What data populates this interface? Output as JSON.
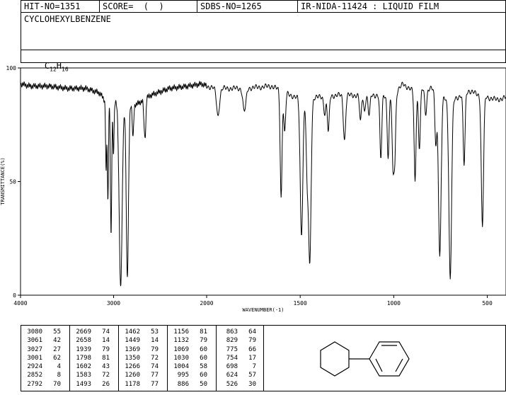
{
  "header": {
    "hit_no": "HIT-NO=1351",
    "score": "SCORE=  (  )",
    "sdbs_no": "SDBS-NO=1265",
    "method": "IR-NIDA-11424 : LIQUID FILM"
  },
  "compound": {
    "name": "CYCLOHEXYLBENZENE",
    "formula_c": "C",
    "formula_c_sub": "12",
    "formula_h": "H",
    "formula_h_sub": "16"
  },
  "chart_data": {
    "type": "line",
    "xlabel": "WAVENUMBER(-1)",
    "ylabel": "TRANSMITTANCE(%)",
    "xlim": [
      4000,
      400
    ],
    "ylim": [
      0,
      100
    ],
    "x_ticks": [
      4000,
      3000,
      2000,
      1500,
      1000,
      500
    ],
    "x_tick_labels": [
      "4000",
      "3000",
      "2000",
      "1500",
      "1000",
      "500"
    ],
    "y_ticks": [
      0,
      50,
      100
    ],
    "y_tick_labels": [
      "0",
      "50",
      "100"
    ],
    "baseline": [
      [
        4000,
        93
      ],
      [
        3900,
        92
      ],
      [
        3700,
        92
      ],
      [
        3500,
        91
      ],
      [
        3300,
        91
      ],
      [
        3150,
        89
      ],
      [
        3100,
        86
      ],
      [
        2750,
        84
      ],
      [
        2600,
        88
      ],
      [
        2400,
        91
      ],
      [
        2200,
        92
      ],
      [
        2050,
        93
      ],
      [
        1950,
        91
      ],
      [
        1800,
        91
      ],
      [
        1650,
        92
      ],
      [
        1580,
        89
      ],
      [
        1520,
        87
      ],
      [
        1420,
        87
      ],
      [
        1300,
        88
      ],
      [
        1150,
        88
      ],
      [
        1000,
        88
      ],
      [
        950,
        93
      ],
      [
        900,
        90
      ],
      [
        800,
        91
      ],
      [
        700,
        85
      ],
      [
        600,
        90
      ],
      [
        540,
        88
      ],
      [
        450,
        86
      ],
      [
        400,
        87
      ]
    ],
    "peaks": [
      {
        "x": 3080,
        "y": 55,
        "w": 6
      },
      {
        "x": 3061,
        "y": 42,
        "w": 6
      },
      {
        "x": 3027,
        "y": 27,
        "w": 7
      },
      {
        "x": 3001,
        "y": 62,
        "w": 6
      },
      {
        "x": 2924,
        "y": 4,
        "w": 16
      },
      {
        "x": 2852,
        "y": 8,
        "w": 12
      },
      {
        "x": 2792,
        "y": 70,
        "w": 8
      },
      {
        "x": 2669,
        "y": 74,
        "w": 8
      },
      {
        "x": 2658,
        "y": 74,
        "w": 6
      },
      {
        "x": 1939,
        "y": 79,
        "w": 8
      },
      {
        "x": 1798,
        "y": 81,
        "w": 8
      },
      {
        "x": 1602,
        "y": 43,
        "w": 5
      },
      {
        "x": 1583,
        "y": 72,
        "w": 5
      },
      {
        "x": 1493,
        "y": 26,
        "w": 7
      },
      {
        "x": 1462,
        "y": 53,
        "w": 6
      },
      {
        "x": 1449,
        "y": 14,
        "w": 7
      },
      {
        "x": 1369,
        "y": 79,
        "w": 5
      },
      {
        "x": 1350,
        "y": 72,
        "w": 5
      },
      {
        "x": 1266,
        "y": 74,
        "w": 5
      },
      {
        "x": 1260,
        "y": 77,
        "w": 5
      },
      {
        "x": 1178,
        "y": 77,
        "w": 5
      },
      {
        "x": 1156,
        "y": 81,
        "w": 5
      },
      {
        "x": 1132,
        "y": 79,
        "w": 5
      },
      {
        "x": 1069,
        "y": 60,
        "w": 5
      },
      {
        "x": 1030,
        "y": 60,
        "w": 5
      },
      {
        "x": 1004,
        "y": 58,
        "w": 5
      },
      {
        "x": 995,
        "y": 60,
        "w": 5
      },
      {
        "x": 886,
        "y": 50,
        "w": 5
      },
      {
        "x": 863,
        "y": 64,
        "w": 5
      },
      {
        "x": 829,
        "y": 79,
        "w": 5
      },
      {
        "x": 775,
        "y": 66,
        "w": 5
      },
      {
        "x": 754,
        "y": 17,
        "w": 7
      },
      {
        "x": 698,
        "y": 7,
        "w": 7
      },
      {
        "x": 624,
        "y": 57,
        "w": 5
      },
      {
        "x": 526,
        "y": 30,
        "w": 6
      }
    ],
    "peak_table": [
      [
        [
          "3080",
          "55"
        ],
        [
          "3061",
          "42"
        ],
        [
          "3027",
          "27"
        ],
        [
          "3001",
          "62"
        ],
        [
          "2924",
          "4"
        ],
        [
          "2852",
          "8"
        ],
        [
          "2792",
          "70"
        ]
      ],
      [
        [
          "2669",
          "74"
        ],
        [
          "2658",
          "14"
        ],
        [
          "1939",
          "79"
        ],
        [
          "1798",
          "81"
        ],
        [
          "1602",
          "43"
        ],
        [
          "1583",
          "72"
        ],
        [
          "1493",
          "26"
        ]
      ],
      [
        [
          "1462",
          "53"
        ],
        [
          "1449",
          "14"
        ],
        [
          "1369",
          "79"
        ],
        [
          "1350",
          "72"
        ],
        [
          "1266",
          "74"
        ],
        [
          "1260",
          "77"
        ],
        [
          "1178",
          "77"
        ]
      ],
      [
        [
          "1156",
          "81"
        ],
        [
          "1132",
          "79"
        ],
        [
          "1069",
          "60"
        ],
        [
          "1030",
          "60"
        ],
        [
          "1004",
          "58"
        ],
        [
          "995",
          "60"
        ],
        [
          "886",
          "50"
        ]
      ],
      [
        [
          "863",
          "64"
        ],
        [
          "829",
          "79"
        ],
        [
          "775",
          "66"
        ],
        [
          "754",
          "17"
        ],
        [
          "698",
          "7"
        ],
        [
          "624",
          "57"
        ],
        [
          "526",
          "30"
        ]
      ]
    ]
  }
}
